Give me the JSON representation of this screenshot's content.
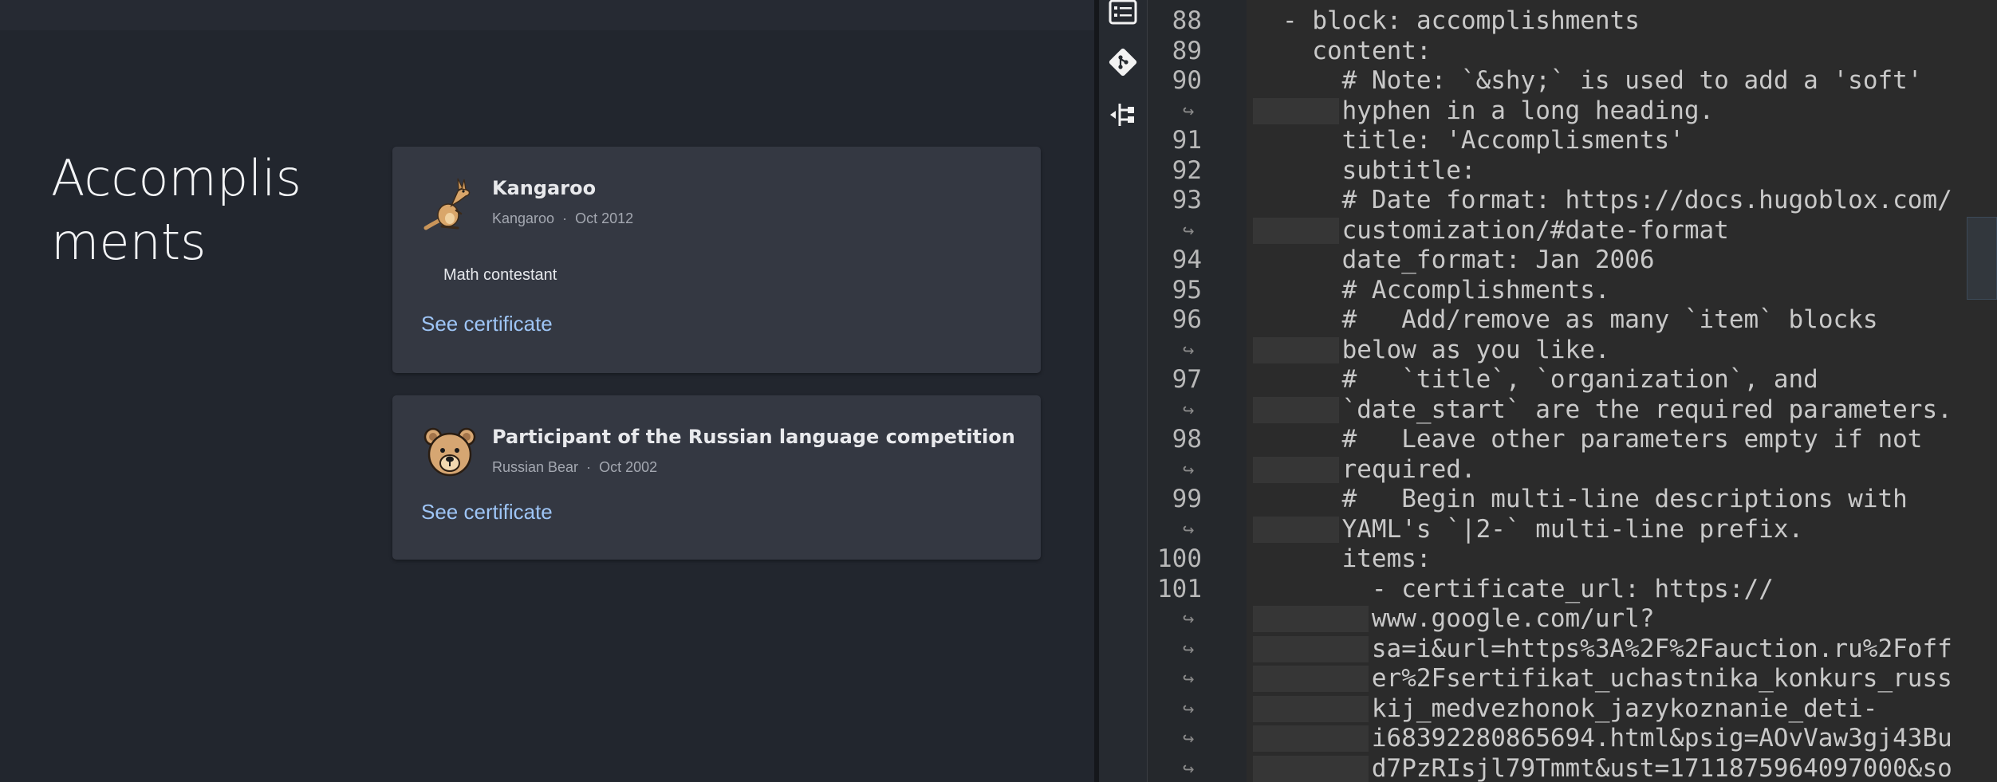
{
  "preview": {
    "section_title_line1": "Accomplis",
    "section_title_line2": "ments",
    "cards": [
      {
        "title": "Kangaroo",
        "organization": "Kangaroo",
        "separator": "·",
        "date": "Oct 2012",
        "description": "Math contestant",
        "link": "See certificate",
        "avatar_icon": "kangaroo-icon"
      },
      {
        "title": "Participant of the Russian language competition",
        "organization": "Russian Bear",
        "separator": "·",
        "date": "Oct 2002",
        "description": "",
        "link": "See certificate",
        "avatar_icon": "bear-icon"
      }
    ]
  },
  "activity_bar": {
    "icons": [
      "outline-icon",
      "git-icon",
      "source-control-tree-icon"
    ]
  },
  "editor": {
    "rows": [
      {
        "ln": "88",
        "wrap": false,
        "indent": 1,
        "text": "- block: accomplishments"
      },
      {
        "ln": "89",
        "wrap": false,
        "indent": 2,
        "text": "content:"
      },
      {
        "ln": "90",
        "wrap": false,
        "indent": 3,
        "text": "# Note: `&shy;` is used to add a 'soft'"
      },
      {
        "ln": "",
        "wrap": true,
        "indent": 3,
        "text": "hyphen in a long heading."
      },
      {
        "ln": "91",
        "wrap": false,
        "indent": 3,
        "text": "title: 'Accomplisments'"
      },
      {
        "ln": "92",
        "wrap": false,
        "indent": 3,
        "text": "subtitle:"
      },
      {
        "ln": "93",
        "wrap": false,
        "indent": 3,
        "text": "# Date format: https://docs.hugoblox.com/"
      },
      {
        "ln": "",
        "wrap": true,
        "indent": 3,
        "text": "customization/#date-format"
      },
      {
        "ln": "94",
        "wrap": false,
        "indent": 3,
        "text": "date_format: Jan 2006"
      },
      {
        "ln": "95",
        "wrap": false,
        "indent": 3,
        "text": "# Accomplishments."
      },
      {
        "ln": "96",
        "wrap": false,
        "indent": 3,
        "text": "#   Add/remove as many `item` blocks"
      },
      {
        "ln": "",
        "wrap": true,
        "indent": 3,
        "text": "below as you like."
      },
      {
        "ln": "97",
        "wrap": false,
        "indent": 3,
        "text": "#   `title`, `organization`, and"
      },
      {
        "ln": "",
        "wrap": true,
        "indent": 3,
        "text": "`date_start` are the required parameters."
      },
      {
        "ln": "98",
        "wrap": false,
        "indent": 3,
        "text": "#   Leave other parameters empty if not"
      },
      {
        "ln": "",
        "wrap": true,
        "indent": 3,
        "text": "required."
      },
      {
        "ln": "99",
        "wrap": false,
        "indent": 3,
        "text": "#   Begin multi-line descriptions with"
      },
      {
        "ln": "",
        "wrap": true,
        "indent": 3,
        "text": "YAML's `|2-` multi-line prefix."
      },
      {
        "ln": "100",
        "wrap": false,
        "indent": 3,
        "text": "items:"
      },
      {
        "ln": "101",
        "wrap": false,
        "indent": 4,
        "text": "- certificate_url: https://"
      },
      {
        "ln": "",
        "wrap": true,
        "indent": 4,
        "text": "www.google.com/url?"
      },
      {
        "ln": "",
        "wrap": true,
        "indent": 4,
        "text": "sa=i&url=https%3A%2F%2Fauction.ru%2Foff"
      },
      {
        "ln": "",
        "wrap": true,
        "indent": 4,
        "text": "er%2Fsertifikat_uchastnika_konkurs_russ"
      },
      {
        "ln": "",
        "wrap": true,
        "indent": 4,
        "text": "kij_medvezhonok_jazykoznanie_deti-"
      },
      {
        "ln": "",
        "wrap": true,
        "indent": 4,
        "text": "i68392280865694.html&psig=AOvVaw3gj43Bu"
      },
      {
        "ln": "",
        "wrap": true,
        "indent": 4,
        "text": "d7PzRIsjl79Tmmt&ust=1711875964097000&so"
      }
    ],
    "wrap_glyph": "↪"
  }
}
